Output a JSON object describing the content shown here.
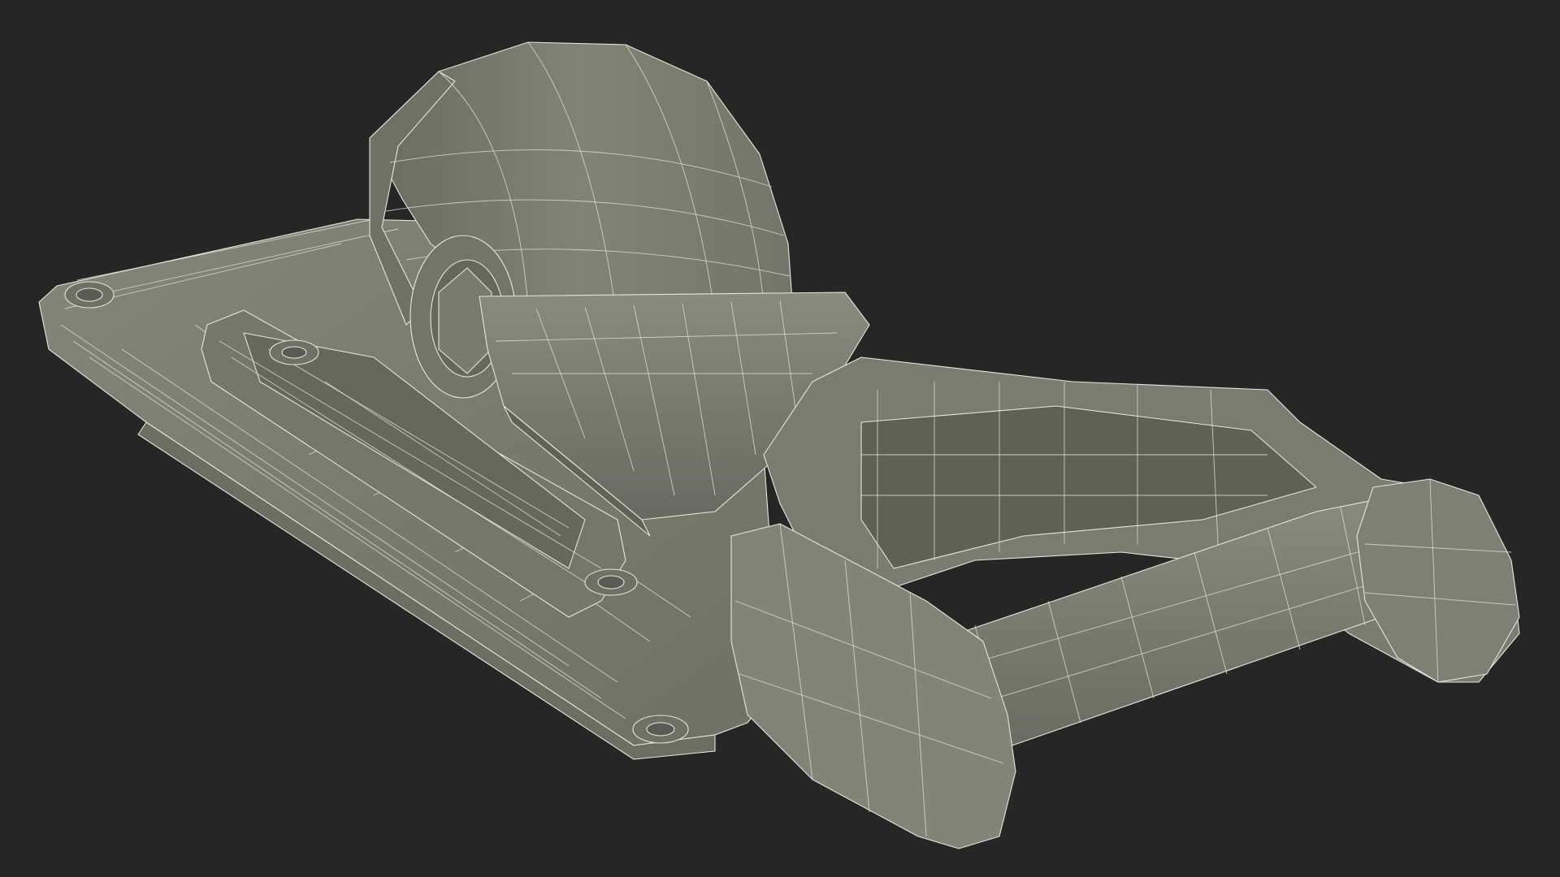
{
  "scene": {
    "background_color": "#262626",
    "model_color": "#7d7e72",
    "model_color_dark": "#5e5f55",
    "model_color_light": "#8e8f83",
    "wire_color": "#e6e6dc"
  }
}
